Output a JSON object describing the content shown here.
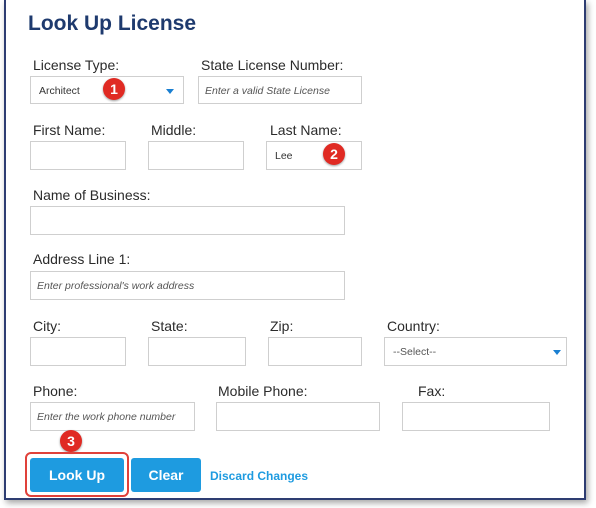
{
  "title": "Look Up License",
  "license_type": {
    "label": "License Type:",
    "value": "Architect"
  },
  "state_license": {
    "label": "State License Number:",
    "placeholder": "Enter a valid State License"
  },
  "first_name": {
    "label": "First Name:",
    "value": ""
  },
  "middle": {
    "label": "Middle:",
    "value": ""
  },
  "last_name": {
    "label": "Last Name:",
    "value": "Lee"
  },
  "business": {
    "label": "Name of Business:",
    "value": ""
  },
  "address1": {
    "label": "Address Line 1:",
    "placeholder": "Enter professional's work address"
  },
  "city": {
    "label": "City:",
    "value": ""
  },
  "state": {
    "label": "State:",
    "value": ""
  },
  "zip": {
    "label": "Zip:",
    "value": ""
  },
  "country": {
    "label": "Country:",
    "value": "--Select--"
  },
  "phone": {
    "label": "Phone:",
    "placeholder": "Enter the work phone number"
  },
  "mobile": {
    "label": "Mobile Phone:",
    "value": ""
  },
  "fax": {
    "label": "Fax:",
    "value": ""
  },
  "buttons": {
    "lookup": "Look Up",
    "clear": "Clear",
    "discard": "Discard Changes"
  },
  "badges": {
    "one": "1",
    "two": "2",
    "three": "3"
  },
  "colors": {
    "title": "#1e3a6e",
    "button": "#1e9be0",
    "badge": "#e02a23",
    "frame": "#2e3d72"
  }
}
